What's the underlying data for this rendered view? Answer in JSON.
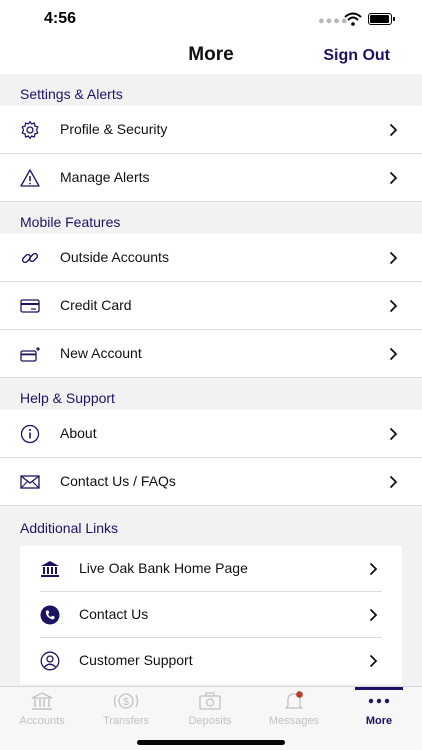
{
  "status": {
    "time": "4:56"
  },
  "header": {
    "title": "More",
    "sign_out": "Sign Out"
  },
  "sections": [
    {
      "title": "Settings & Alerts",
      "items": [
        {
          "label": "Profile & Security",
          "icon": "gear-icon"
        },
        {
          "label": "Manage Alerts",
          "icon": "warning-icon"
        }
      ]
    },
    {
      "title": "Mobile Features",
      "items": [
        {
          "label": "Outside Accounts",
          "icon": "link-icon"
        },
        {
          "label": "Credit Card",
          "icon": "credit-card-icon"
        },
        {
          "label": "New Account",
          "icon": "new-card-icon"
        }
      ]
    },
    {
      "title": "Help & Support",
      "items": [
        {
          "label": "About",
          "icon": "info-icon"
        },
        {
          "label": "Contact Us / FAQs",
          "icon": "envelope-icon"
        }
      ]
    }
  ],
  "additional": {
    "title": "Additional Links",
    "items": [
      {
        "label": "Live Oak Bank Home Page",
        "icon": "bank-icon"
      },
      {
        "label": "Contact Us",
        "icon": "phone-icon"
      },
      {
        "label": "Customer Support",
        "icon": "user-circle-icon"
      }
    ]
  },
  "tabs": [
    {
      "label": "Accounts",
      "icon": "bank-icon",
      "active": false
    },
    {
      "label": "Transfers",
      "icon": "transfer-icon",
      "active": false
    },
    {
      "label": "Deposits",
      "icon": "check-deposit-icon",
      "active": false
    },
    {
      "label": "Messages",
      "icon": "bell-icon",
      "active": false
    },
    {
      "label": "More",
      "icon": "more-dots-icon",
      "active": true
    }
  ],
  "colors": {
    "accent": "#1b1464",
    "notification": "#c0392b",
    "inactive": "#c2c2c2"
  }
}
